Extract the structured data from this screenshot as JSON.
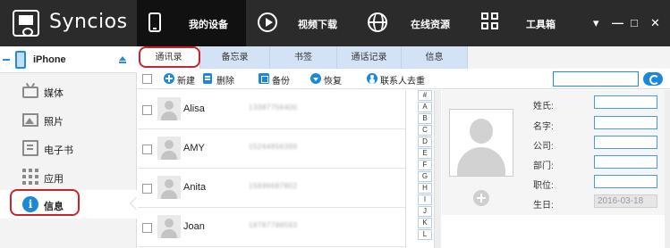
{
  "app": {
    "name": "Syncios"
  },
  "nav": {
    "tabs": [
      {
        "label": "我的设备",
        "icon": "phone-icon"
      },
      {
        "label": "视频下载",
        "icon": "play-icon"
      },
      {
        "label": "在线资源",
        "icon": "globe-icon"
      },
      {
        "label": "工具箱",
        "icon": "toolbox-grid-icon"
      }
    ],
    "window_controls": {
      "menu": "▾",
      "minimize": "—",
      "maximize": "□",
      "close": "✕"
    }
  },
  "device": {
    "name": "iPhone"
  },
  "sidebar": {
    "items": [
      {
        "label": "媒体",
        "icon": "tv-icon"
      },
      {
        "label": "照片",
        "icon": "photo-icon"
      },
      {
        "label": "电子书",
        "icon": "book-icon"
      },
      {
        "label": "应用",
        "icon": "apps-grid-icon"
      },
      {
        "label": "信息",
        "icon": "info-icon",
        "active": true
      }
    ]
  },
  "subtabs": [
    "通讯录",
    "备忘录",
    "书签",
    "通话记录",
    "信息"
  ],
  "toolbar": {
    "new": "新建",
    "delete": "删除",
    "backup": "备份",
    "restore": "恢复",
    "dedupe": "联系人去重"
  },
  "contacts": [
    {
      "name": "Alisa",
      "phone": "13387756400"
    },
    {
      "name": "AMY",
      "phone": "15244856399"
    },
    {
      "name": "Anita",
      "phone": "15696687802"
    },
    {
      "name": "Joan",
      "phone": "18787788593"
    }
  ],
  "alphabet": [
    "#",
    "A",
    "B",
    "C",
    "D",
    "E",
    "F",
    "G",
    "H",
    "I",
    "J",
    "K",
    "L"
  ],
  "detail": {
    "labels": {
      "last_name": "姓氏:",
      "first_name": "名字:",
      "company": "公司:",
      "department": "部门:",
      "title": "职位:",
      "birthday": "生日:"
    },
    "birthday_value": "2016-03-18"
  },
  "colors": {
    "accent": "#1e88d8",
    "highlight_ring": "#c8242b",
    "topbar": "#2b2b2b"
  }
}
